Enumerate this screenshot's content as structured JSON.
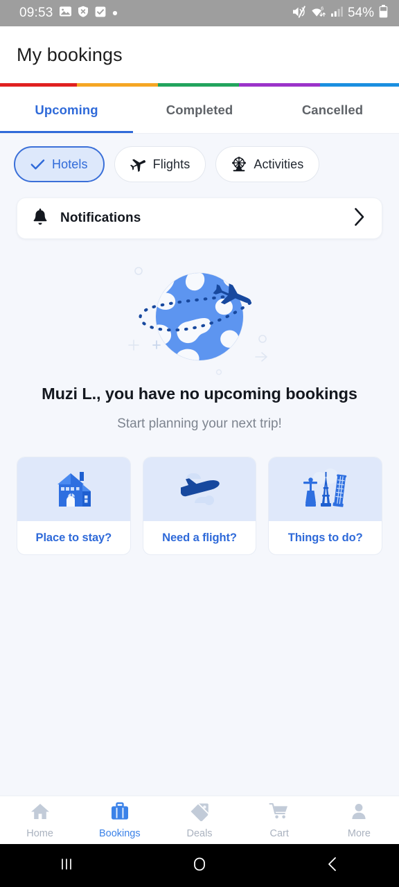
{
  "status_bar": {
    "time": "09:53",
    "battery_percent": "54%",
    "left_icons": [
      "image-icon",
      "shield-x-icon",
      "checkbox-icon",
      "dot-icon"
    ],
    "right_icons": [
      "mute-icon",
      "wifi-6-icon",
      "signal-icon",
      "battery-icon"
    ],
    "background_color": "#9e9e9e"
  },
  "header": {
    "title": "My bookings"
  },
  "accent_stripe": {
    "colors": [
      "#e02020",
      "#f5a623",
      "#22a45d",
      "#9b33c9",
      "#1a8fe0"
    ]
  },
  "tabs": {
    "items": [
      {
        "label": "Upcoming",
        "active": true
      },
      {
        "label": "Completed",
        "active": false
      },
      {
        "label": "Cancelled",
        "active": false
      }
    ],
    "active_color": "#2f6ad9",
    "inactive_color": "#5f6368"
  },
  "filter_chips": [
    {
      "label": "Hotels",
      "icon": "check-icon",
      "selected": true
    },
    {
      "label": "Flights",
      "icon": "airplane-icon",
      "selected": false
    },
    {
      "label": "Activities",
      "icon": "ferris-wheel-icon",
      "selected": false
    }
  ],
  "notifications": {
    "label": "Notifications",
    "icon": "bell-icon",
    "chevron": "chevron-right-icon"
  },
  "empty_state": {
    "illustration": "globe-with-airplane-illustration",
    "title": "Muzi L., you have no upcoming bookings",
    "subtitle": "Start planning your next trip!"
  },
  "action_cards": [
    {
      "label": "Place to stay?",
      "icon": "house-icon"
    },
    {
      "label": "Need a flight?",
      "icon": "airplane-takeoff-icon"
    },
    {
      "label": "Things to do?",
      "icon": "landmarks-icon"
    }
  ],
  "bottom_nav": [
    {
      "label": "Home",
      "icon": "home-icon",
      "active": false
    },
    {
      "label": "Bookings",
      "icon": "briefcase-icon",
      "active": true
    },
    {
      "label": "Deals",
      "icon": "tag-icon",
      "active": false
    },
    {
      "label": "Cart",
      "icon": "cart-icon",
      "active": false
    },
    {
      "label": "More",
      "icon": "person-icon",
      "active": false
    }
  ],
  "android_nav": [
    {
      "icon": "recents-icon"
    },
    {
      "icon": "home-circle-icon"
    },
    {
      "icon": "back-icon"
    }
  ],
  "colors": {
    "brand_blue": "#2f6ad9",
    "page_background": "#f5f7fc",
    "card_background": "#ffffff",
    "chip_selected_fill": "#dde8fb",
    "illustration_blue": "#5d95f0",
    "illustration_dark_blue": "#17489e"
  }
}
